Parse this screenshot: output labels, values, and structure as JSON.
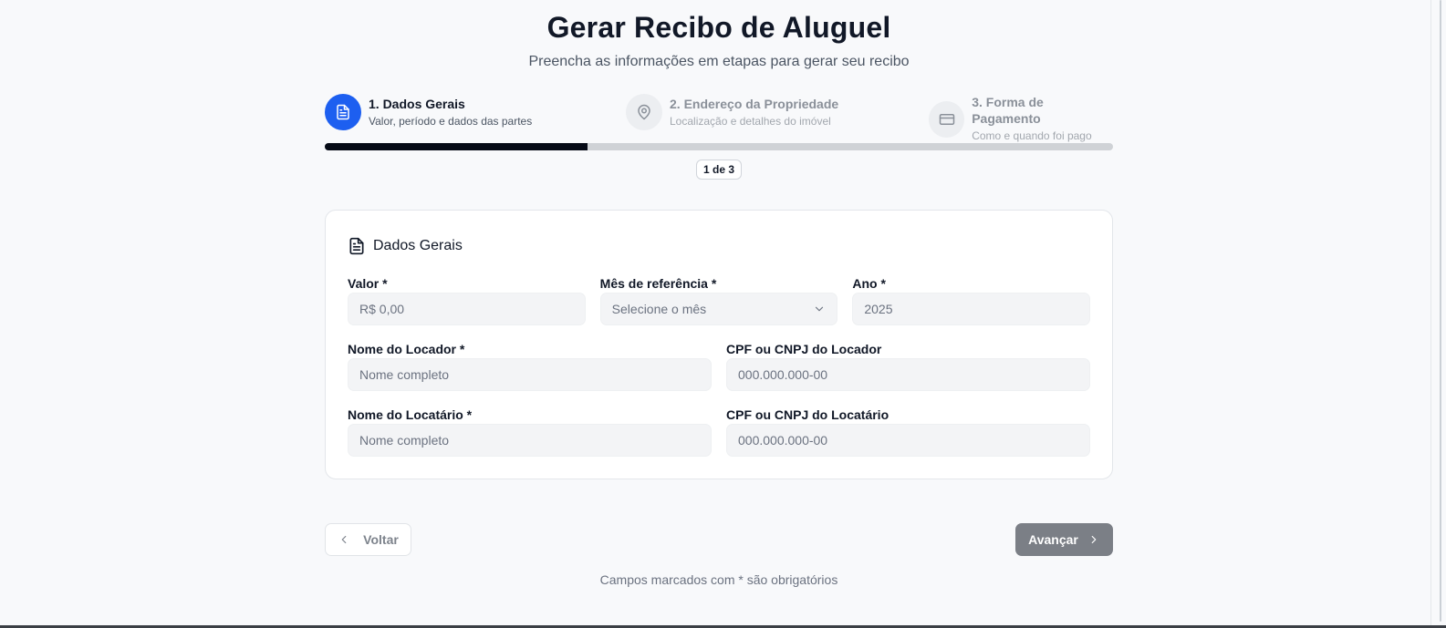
{
  "header": {
    "title": "Gerar Recibo de Aluguel",
    "subtitle": "Preencha as informações em etapas para gerar seu recibo"
  },
  "steps": [
    {
      "title": "1. Dados Gerais",
      "description": "Valor, período e dados das partes",
      "icon": "document-icon",
      "status": "active"
    },
    {
      "title": "2. Endereço da Propriedade",
      "description": "Localização e detalhes do imóvel",
      "icon": "map-pin-icon",
      "status": "pending"
    },
    {
      "title": "3. Forma de Pagamento",
      "description": "Como e quando foi pago",
      "icon": "credit-card-icon",
      "status": "pending"
    }
  ],
  "progress": {
    "fraction": 0.333,
    "label": "1 de 3"
  },
  "card": {
    "title": "Dados Gerais",
    "fields": {
      "valor": {
        "label": "Valor *",
        "placeholder": "R$ 0,00"
      },
      "mes": {
        "label": "Mês de referência *",
        "placeholder": "Selecione o mês"
      },
      "ano": {
        "label": "Ano *",
        "value": "2025"
      },
      "locador_nome": {
        "label": "Nome do Locador *",
        "placeholder": "Nome completo"
      },
      "locador_doc": {
        "label": "CPF ou CNPJ do Locador",
        "placeholder": "000.000.000-00"
      },
      "locatario_nome": {
        "label": "Nome do Locatário *",
        "placeholder": "Nome completo"
      },
      "locatario_doc": {
        "label": "CPF ou CNPJ do Locatário",
        "placeholder": "000.000.000-00"
      }
    }
  },
  "nav": {
    "back_label": "Voltar",
    "next_label": "Avançar"
  },
  "footnote": "Campos marcados com * são obrigatórios",
  "colors": {
    "accent": "#1d5ff0",
    "progress": "#050a16",
    "next_button": "#7b7f86"
  }
}
